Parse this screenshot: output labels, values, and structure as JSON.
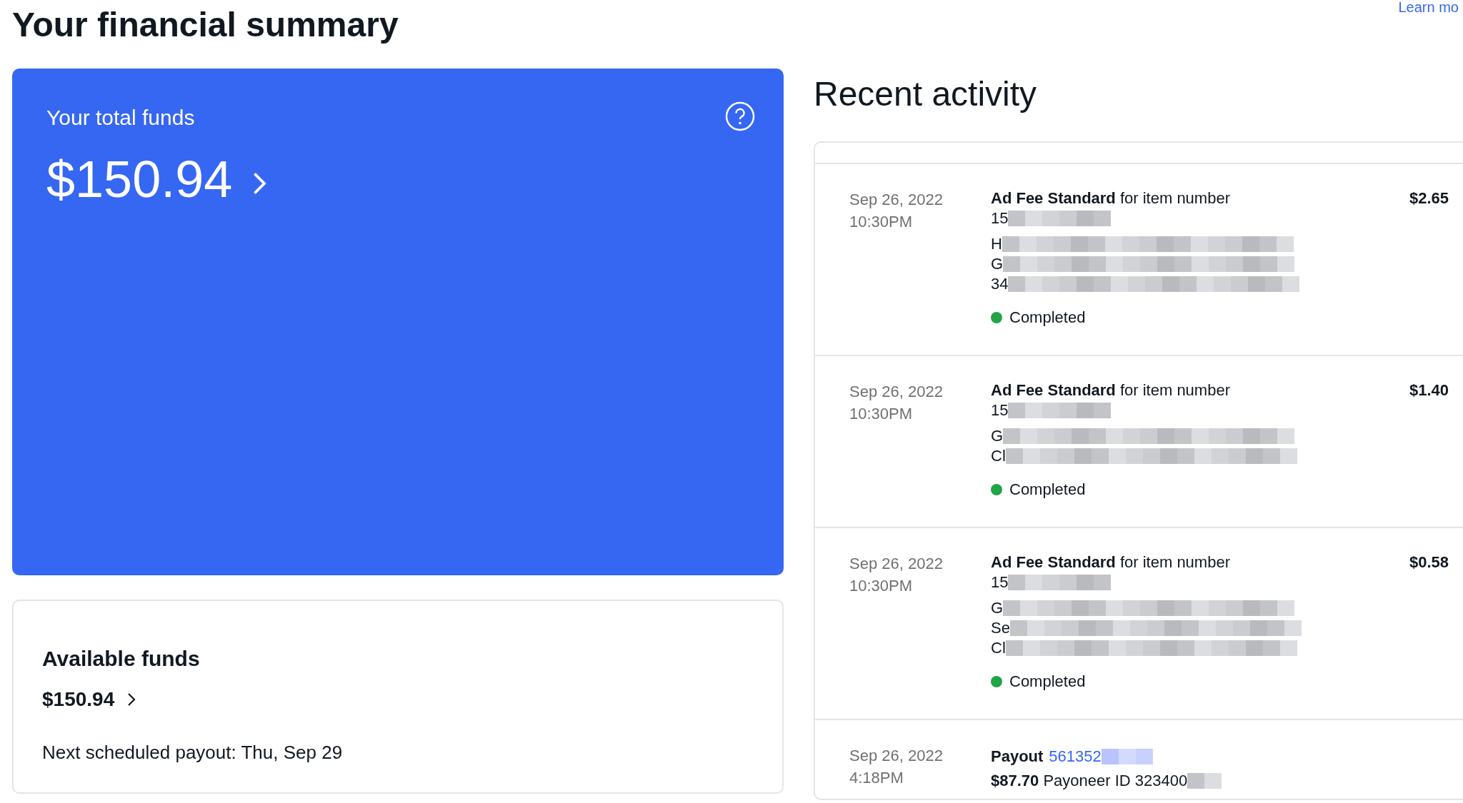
{
  "title": "Your financial summary",
  "top_link": "Learn mo",
  "total_card": {
    "label": "Your total funds",
    "amount": "$150.94"
  },
  "available_card": {
    "title": "Available funds",
    "amount": "$150.94",
    "payout_note": "Next scheduled payout: Thu, Sep 29"
  },
  "recent_activity": {
    "title": "Recent activity",
    "rows": [
      {
        "kind": "fee",
        "date": "Sep 26, 2022",
        "time": "10:30PM",
        "description": "**Ad Fee Standard** for item number",
        "lines": [
          "15",
          "H",
          "G",
          "34"
        ],
        "status": {
          "label": "Completed",
          "color": "#22a447"
        },
        "amount": "$2.65"
      },
      {
        "kind": "fee",
        "date": "Sep 26, 2022",
        "time": "10:30PM",
        "description": "**Ad Fee Standard** for item number",
        "lines": [
          "15",
          "G",
          "Cl"
        ],
        "status": {
          "label": "Completed",
          "color": "#22a447"
        },
        "amount": "$1.40"
      },
      {
        "kind": "fee",
        "date": "Sep 26, 2022",
        "time": "10:30PM",
        "description": "**Ad Fee Standard** for item number",
        "lines": [
          "15",
          "G",
          "Se",
          "Cl"
        ],
        "status": {
          "label": "Completed",
          "color": "#22a447"
        },
        "amount": "$0.58"
      },
      {
        "kind": "payout",
        "date": "Sep 26, 2022",
        "time": "4:18PM",
        "label": "Payout",
        "link": "561352",
        "detail": "**$87.70** Payoneer ID 323400"
      }
    ]
  }
}
